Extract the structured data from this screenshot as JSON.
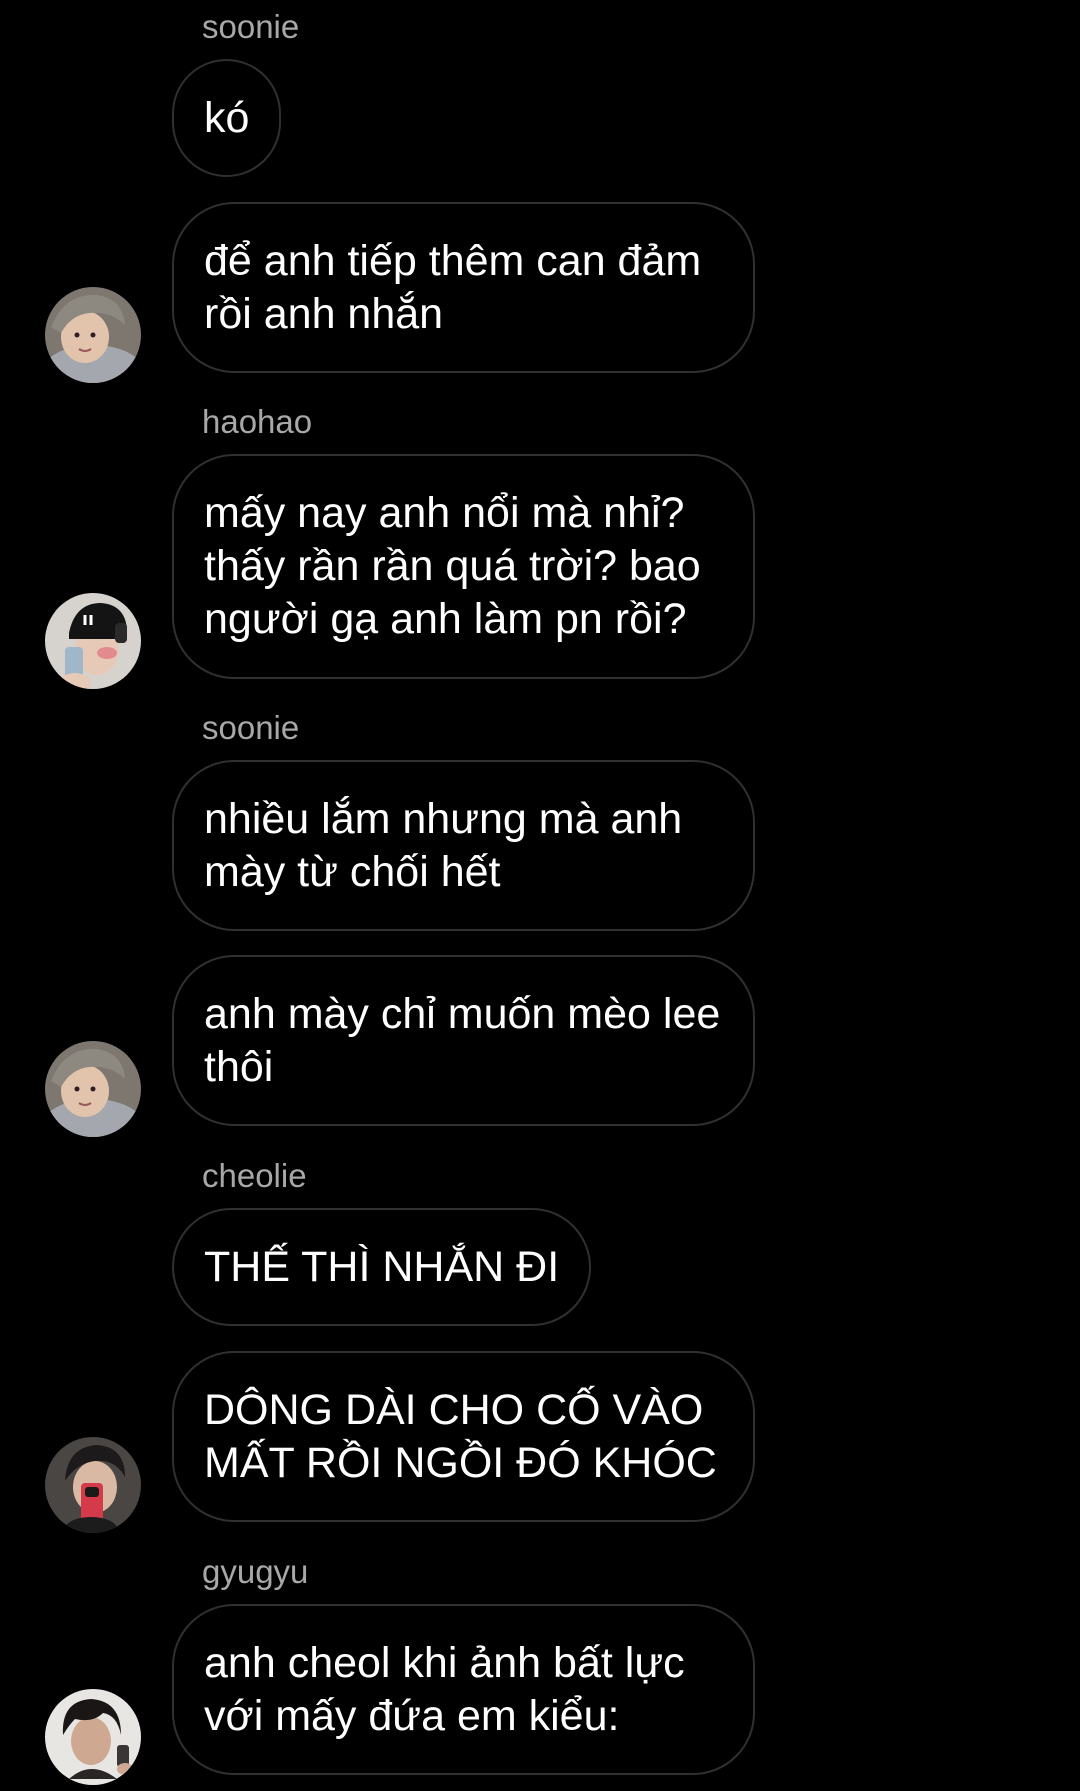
{
  "messages": [
    {
      "sender": "soonie",
      "text": "kó"
    },
    {
      "text": "để anh tiếp thêm can đảm rồi anh nhắn"
    },
    {
      "sender": "haohao",
      "text": "mấy nay anh nổi mà nhỉ? thấy rần rần quá trời? bao người gạ anh làm pn rồi?"
    },
    {
      "sender": "soonie",
      "text": "nhiều lắm nhưng mà anh mày từ chối hết"
    },
    {
      "text": "anh mày chỉ muốn mèo lee thôi"
    },
    {
      "sender": "cheolie",
      "text": "THẾ THÌ NHẮN ĐI"
    },
    {
      "text": "DÔNG DÀI CHO CỐ VÀO MẤT RỒI NGỒI ĐÓ KHÓC"
    },
    {
      "sender": "gyugyu",
      "text": "anh cheol khi ảnh bất lực với mấy đứa em kiểu:"
    }
  ],
  "avatars": [
    {
      "icon": "avatar-soonie-icon"
    },
    {
      "icon": "avatar-haohao-icon"
    },
    {
      "icon": "avatar-soonie-icon"
    },
    {
      "icon": "avatar-cheolie-icon"
    },
    {
      "icon": "avatar-gyugyu-icon"
    }
  ],
  "colors": {
    "background": "#000000",
    "bubble_border": "#303030",
    "sender_text": "#a8a8a8",
    "message_text": "#ffffff"
  }
}
